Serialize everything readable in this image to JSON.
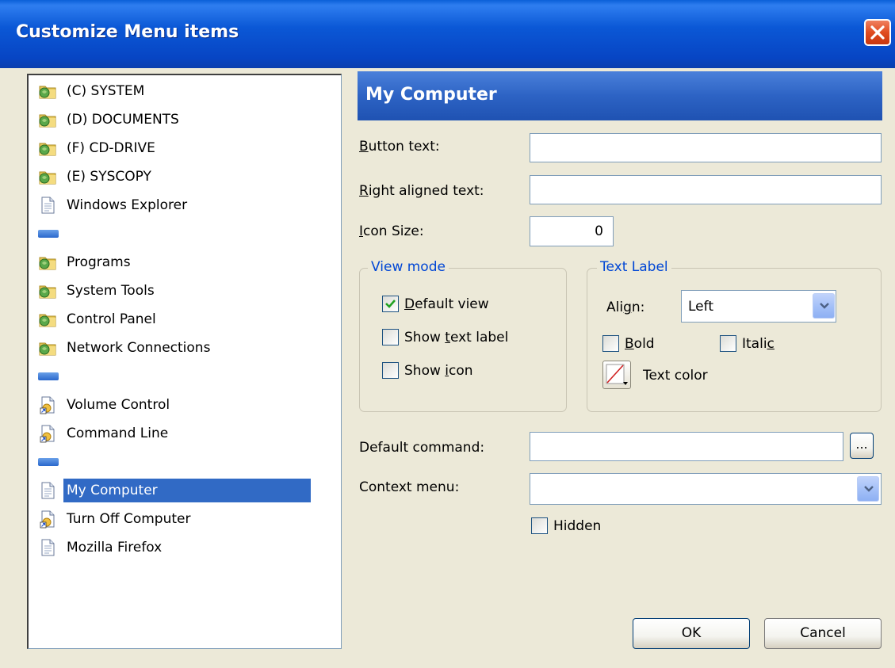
{
  "window": {
    "title": "Customize Menu items"
  },
  "tree": {
    "items": [
      {
        "label": "(C) SYSTEM",
        "icon": "folder-icon"
      },
      {
        "label": "(D) DOCUMENTS",
        "icon": "folder-icon"
      },
      {
        "label": "(F) CD-DRIVE",
        "icon": "folder-icon"
      },
      {
        "label": "(E) SYSCOPY",
        "icon": "folder-icon"
      },
      {
        "label": "Windows Explorer",
        "icon": "document-icon"
      },
      {
        "label": "",
        "icon": "separator-icon"
      },
      {
        "label": "Programs",
        "icon": "folder-icon"
      },
      {
        "label": "System Tools",
        "icon": "folder-icon"
      },
      {
        "label": "Control Panel",
        "icon": "folder-icon"
      },
      {
        "label": "Network Connections",
        "icon": "folder-icon"
      },
      {
        "label": "",
        "icon": "separator-icon"
      },
      {
        "label": "Volume Control",
        "icon": "shortcut-icon"
      },
      {
        "label": "Command Line",
        "icon": "shortcut-icon"
      },
      {
        "label": "",
        "icon": "separator-icon"
      },
      {
        "label": "My Computer",
        "icon": "document-icon",
        "selected": true
      },
      {
        "label": "Turn Off Computer",
        "icon": "shortcut-icon"
      },
      {
        "label": "Mozilla Firefox",
        "icon": "document-icon"
      }
    ]
  },
  "details": {
    "header": "My Computer",
    "button_text": {
      "label_pre": "",
      "label_u": "B",
      "label_post": "utton text:",
      "value": ""
    },
    "right_text": {
      "label_pre": "",
      "label_u": "R",
      "label_post": "ight aligned text:",
      "value": ""
    },
    "icon_size": {
      "label_pre": "",
      "label_u": "I",
      "label_post": "con Size:",
      "value": "0"
    },
    "view_mode": {
      "title": "View mode",
      "default_view": {
        "pre": "",
        "u": "D",
        "post": "efault view",
        "checked": true
      },
      "show_text_label": {
        "pre": "Show ",
        "u": "t",
        "post": "ext label",
        "checked": false
      },
      "show_icon": {
        "pre": "Show ",
        "u": "i",
        "post": "con",
        "checked": false
      }
    },
    "text_label": {
      "title": "Text Label",
      "align_label_pre": "Ali",
      "align_label_u": "g",
      "align_label_post": "n:",
      "align_value": "Left",
      "bold": {
        "pre": "",
        "u": "B",
        "post": "old",
        "checked": false
      },
      "italic": {
        "pre": "Itali",
        "u": "c",
        "post": "",
        "checked": false
      },
      "text_color": "Text color"
    },
    "default_command": {
      "label": "Default command:",
      "value": "",
      "browse": "..."
    },
    "context_menu": {
      "label": "Context menu:",
      "value": ""
    },
    "hidden": {
      "label": "Hidden",
      "checked": false
    }
  },
  "buttons": {
    "ok": "OK",
    "cancel": "Cancel"
  },
  "colors": {
    "title_blue": "#0b58d6",
    "selection": "#316ac5",
    "group_title": "#0046d5",
    "close_red": "#e04c20"
  }
}
